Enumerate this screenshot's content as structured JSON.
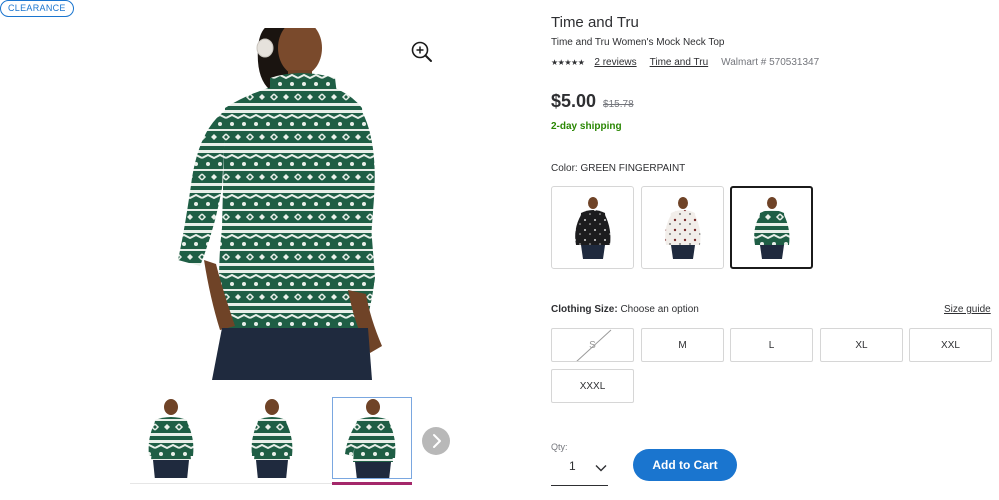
{
  "badge": {
    "label": "CLEARANCE"
  },
  "product": {
    "brand": "Time and Tru",
    "title": "Time and Tru Women's Mock Neck Top",
    "rating_stars": "★★★★★",
    "reviews_link": "2 reviews",
    "brand_link": "Time and Tru",
    "sku": "Walmart # 570531347"
  },
  "pricing": {
    "price": "$5.00",
    "was_price": "$15.78",
    "shipping": "2-day shipping"
  },
  "color": {
    "label": "Color:",
    "selected": "GREEN FINGERPAINT",
    "swatches": [
      "black print",
      "white print",
      "green fingerpaint"
    ]
  },
  "size": {
    "label": "Clothing Size:",
    "prompt": "Choose an option",
    "guide_link": "Size guide",
    "options": [
      "S",
      "M",
      "L",
      "XL",
      "XXL",
      "XXXL"
    ]
  },
  "cart": {
    "qty_label": "Qty:",
    "qty_value": "1",
    "add_label": "Add to Cart"
  },
  "icons": {
    "zoom": "zoom-in-icon",
    "next": "chevron-right-icon",
    "qty": "chevron-down-icon"
  },
  "colors": {
    "accent": "#1a75cf",
    "shipping": "#2a8703",
    "active_thumb_bar": "#a4286a",
    "sweater_green": "#1f5e45"
  }
}
